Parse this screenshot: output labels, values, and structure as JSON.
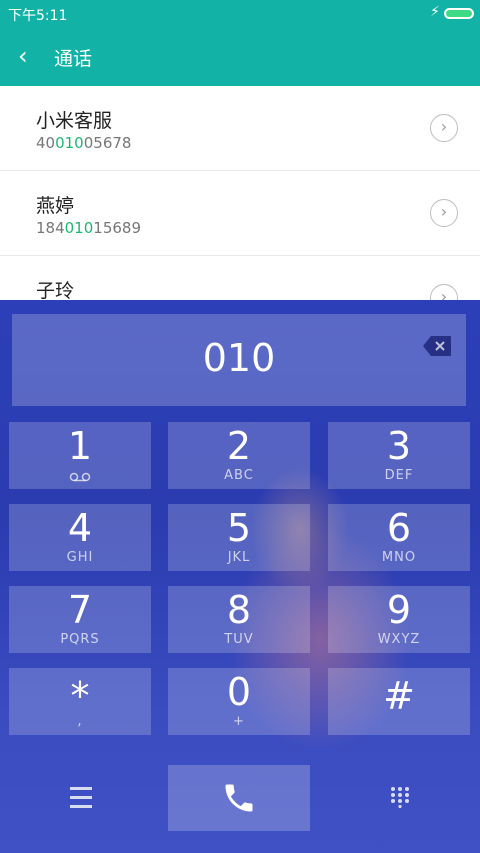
{
  "status": {
    "time": "下午5:11"
  },
  "header": {
    "title": "通话"
  },
  "contacts": [
    {
      "name": "小米客服",
      "num_pre": "40",
      "num_hl": "010",
      "num_post": "05678"
    },
    {
      "name": "燕婷",
      "num_pre": "184",
      "num_hl": "010",
      "num_post": "15689"
    },
    {
      "name": "子玲",
      "num_pre": "",
      "num_hl": "",
      "num_post": ""
    }
  ],
  "dialer": {
    "input": "010",
    "keys": [
      {
        "num": "1",
        "letters": ""
      },
      {
        "num": "2",
        "letters": "ABC"
      },
      {
        "num": "3",
        "letters": "DEF"
      },
      {
        "num": "4",
        "letters": "GHI"
      },
      {
        "num": "5",
        "letters": "JKL"
      },
      {
        "num": "6",
        "letters": "MNO"
      },
      {
        "num": "7",
        "letters": "PQRS"
      },
      {
        "num": "8",
        "letters": "TUV"
      },
      {
        "num": "9",
        "letters": "WXYZ"
      },
      {
        "num": "*",
        "letters": ","
      },
      {
        "num": "0",
        "letters": "+"
      },
      {
        "num": "#",
        "letters": ""
      }
    ]
  },
  "colors": {
    "accent": "#12b3a6",
    "highlight": "#1db870"
  },
  "icons": {
    "back": "back-arrow-icon",
    "voicemail": "voicemail-icon",
    "backspace": "backspace-icon",
    "call": "phone-icon"
  }
}
